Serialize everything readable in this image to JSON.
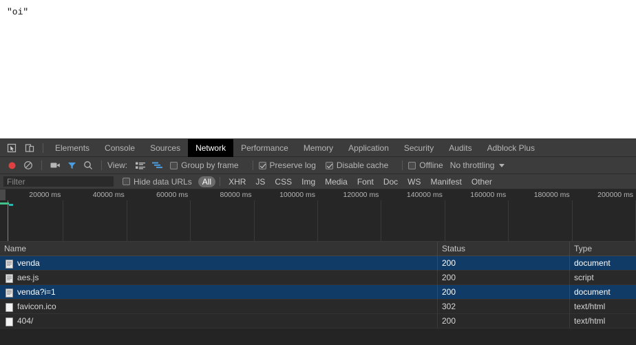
{
  "page": {
    "console_output": "\"oi\""
  },
  "devtools": {
    "left_icons": [
      {
        "name": "inspect-element-icon",
        "title": "Inspect element"
      },
      {
        "name": "device-toolbar-icon",
        "title": "Toggle device toolbar"
      }
    ],
    "tabs": [
      {
        "label": "Elements",
        "active": false
      },
      {
        "label": "Console",
        "active": false
      },
      {
        "label": "Sources",
        "active": false
      },
      {
        "label": "Network",
        "active": true
      },
      {
        "label": "Performance",
        "active": false
      },
      {
        "label": "Memory",
        "active": false
      },
      {
        "label": "Application",
        "active": false
      },
      {
        "label": "Security",
        "active": false
      },
      {
        "label": "Audits",
        "active": false
      },
      {
        "label": "Adblock Plus",
        "active": false
      }
    ],
    "toolbar": {
      "record_icon": "record-button-icon",
      "clear_icon": "clear-icon",
      "capture_screenshots_icon": "camera-icon",
      "filter_icon": "filter-funnel-icon",
      "search_icon": "search-icon",
      "view_label": "View:",
      "view_list_icon": "list-view-icon",
      "view_waterfall_icon": "waterfall-view-icon",
      "group_by_frame": {
        "label": "Group by frame",
        "checked": false
      },
      "preserve_log": {
        "label": "Preserve log",
        "checked": true
      },
      "disable_cache": {
        "label": "Disable cache",
        "checked": true
      },
      "offline": {
        "label": "Offline",
        "checked": false
      },
      "throttling": {
        "value": "No throttling"
      }
    },
    "filterbar": {
      "filter_placeholder": "Filter",
      "filter_value": "",
      "hide_data_urls": {
        "label": "Hide data URLs",
        "checked": false
      },
      "types": [
        {
          "label": "All",
          "selected": true
        },
        {
          "label": "XHR",
          "selected": false
        },
        {
          "label": "JS",
          "selected": false
        },
        {
          "label": "CSS",
          "selected": false
        },
        {
          "label": "Img",
          "selected": false
        },
        {
          "label": "Media",
          "selected": false
        },
        {
          "label": "Font",
          "selected": false
        },
        {
          "label": "Doc",
          "selected": false
        },
        {
          "label": "WS",
          "selected": false
        },
        {
          "label": "Manifest",
          "selected": false
        },
        {
          "label": "Other",
          "selected": false
        }
      ]
    },
    "overview": {
      "ticks": [
        "20000 ms",
        "40000 ms",
        "60000 ms",
        "80000 ms",
        "100000 ms",
        "120000 ms",
        "140000 ms",
        "160000 ms",
        "180000 ms",
        "200000 ms"
      ],
      "dom_content_loaded_color": "#e05c5c",
      "load_event_color": "#41c28a",
      "request_bar_color": "#2ab5b5"
    },
    "requests": {
      "columns": [
        "Name",
        "Status",
        "Type"
      ],
      "rows": [
        {
          "name": "venda",
          "status": "200",
          "type": "document",
          "selected": true,
          "icon": "document-file-icon"
        },
        {
          "name": "aes.js",
          "status": "200",
          "type": "script",
          "selected": false,
          "icon": "document-file-icon"
        },
        {
          "name": "venda?i=1",
          "status": "200",
          "type": "document",
          "selected": true,
          "icon": "document-file-icon"
        },
        {
          "name": "favicon.ico",
          "status": "302",
          "type": "text/html",
          "selected": false,
          "icon": "blank-file-icon"
        },
        {
          "name": "404/",
          "status": "200",
          "type": "text/html",
          "selected": false,
          "icon": "blank-file-icon"
        }
      ]
    }
  }
}
